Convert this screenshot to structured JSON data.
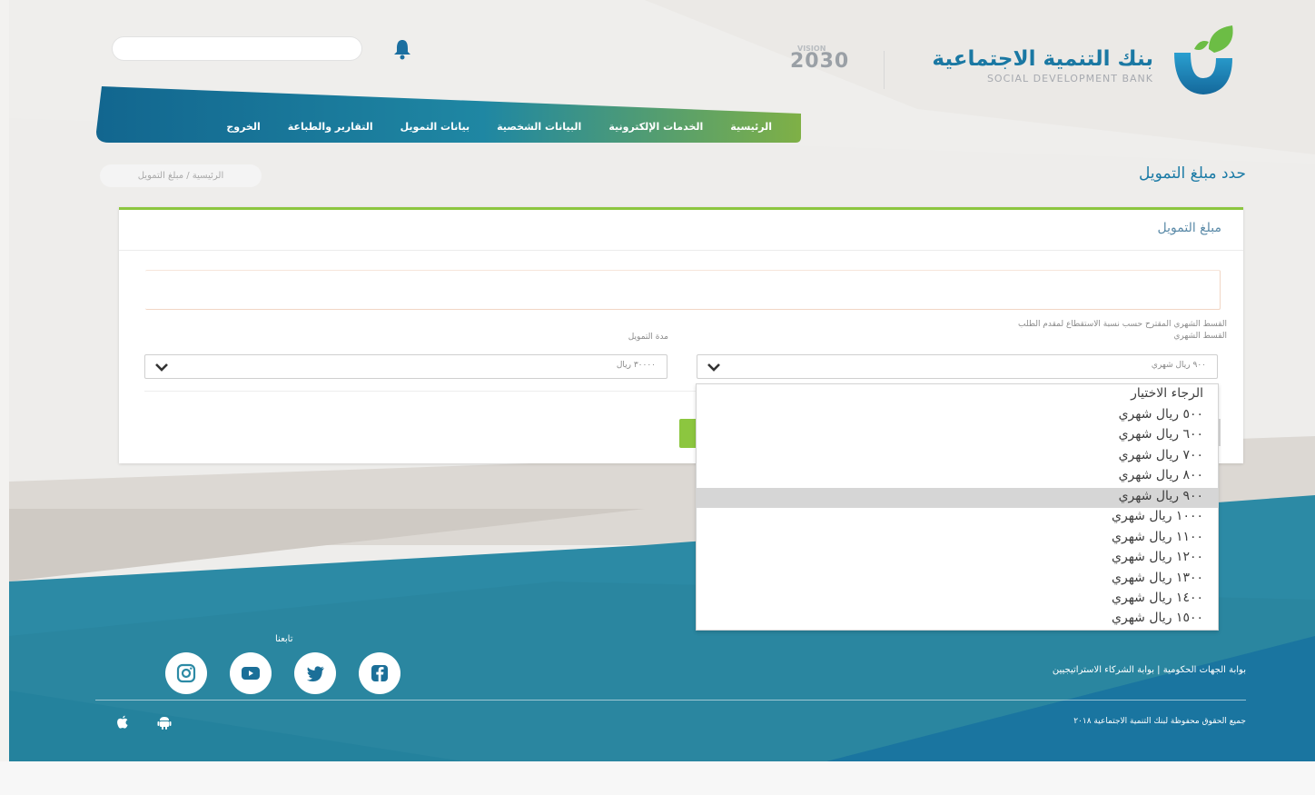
{
  "header": {
    "vision_label": "2030",
    "vision_small": "VISION",
    "brand_ar": "بنك التنمية الاجتماعية",
    "brand_en": "SOCIAL DEVELOPMENT BANK",
    "search_placeholder": ""
  },
  "nav": {
    "items": [
      {
        "label": "الرئيسية"
      },
      {
        "label": "الخدمات الإلكترونية"
      },
      {
        "label": "البيانات الشخصية"
      },
      {
        "label": "بيانات التمويل"
      },
      {
        "label": "التقارير والطباعة"
      },
      {
        "label": "الخروج"
      }
    ]
  },
  "breadcrumb": "الرئيسية / مبلغ التمويل",
  "page_title": "حدد مبلغ التمويل",
  "card": {
    "title": "مبلغ التمويل",
    "installment_hint": "القسط الشهري المقترح حسب نسبة الاستقطاع لمقدم الطلب",
    "installment_label": "القسط الشهري",
    "term_label": "مدة التمويل",
    "term_value": "٣٠٠٠٠ ريال",
    "installment_value": "٩٠٠ ريال شهري"
  },
  "dropdown": {
    "options": [
      "الرجاء الاختيار",
      "٥٠٠ ريال شهري",
      "٦٠٠ ريال شهري",
      "٧٠٠ ريال شهري",
      "٨٠٠ ريال شهري",
      "٩٠٠ ريال شهري",
      "١٠٠٠ ريال شهري",
      "١١٠٠ ريال شهري",
      "١٢٠٠ ريال شهري",
      "١٣٠٠ ريال شهري",
      "١٤٠٠ ريال شهري",
      "١٥٠٠ ريال شهري"
    ],
    "selected": "٩٠٠ ريال شهري"
  },
  "footer": {
    "follow_label": "تابعنا",
    "links": "بوابة الجهات الحكومية | بوابة الشركاء الاستراتيجيين",
    "copyright": "جميع الحقوق محفوظة لبنك التنمية الاجتماعية ٢٠١٨"
  },
  "colors": {
    "primary_blue": "#1b7ba6",
    "accent_green": "#8cc63f",
    "footer_teal": "#2d8ba3"
  }
}
